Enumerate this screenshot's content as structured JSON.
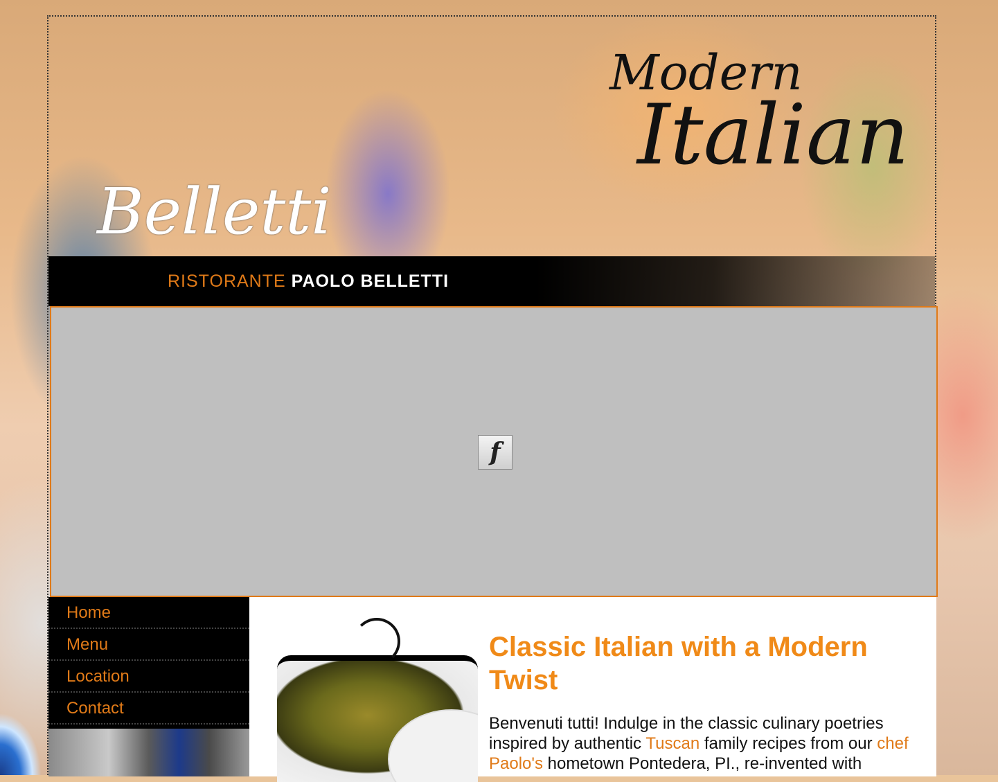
{
  "header": {
    "logo": "Belletti",
    "tagline_part1": "RISTORANTE",
    "tagline_part2": "PAOLO BELLETTI",
    "script_title_line1": "Modern",
    "script_title_line2": "Italian"
  },
  "flash": {
    "icon": "flash-plugin-icon"
  },
  "nav": {
    "items": [
      {
        "label": "Home"
      },
      {
        "label": "Menu"
      },
      {
        "label": "Location"
      },
      {
        "label": "Contact"
      }
    ]
  },
  "main": {
    "heading": "Classic Italian with a Modern Twist",
    "para_1": "Benvenuti tutti! Indulge in the classic culinary poetries inspired by authentic ",
    "para_link_1": "Tuscan",
    "para_2": " family recipes from our ",
    "para_link_2": "chef Paolo's",
    "para_3": " hometown Pontedera, PI., re-invented with"
  },
  "colors": {
    "accent": "#e07a18",
    "nav_bg": "#000000",
    "flash_bg": "#bfbfbf"
  }
}
